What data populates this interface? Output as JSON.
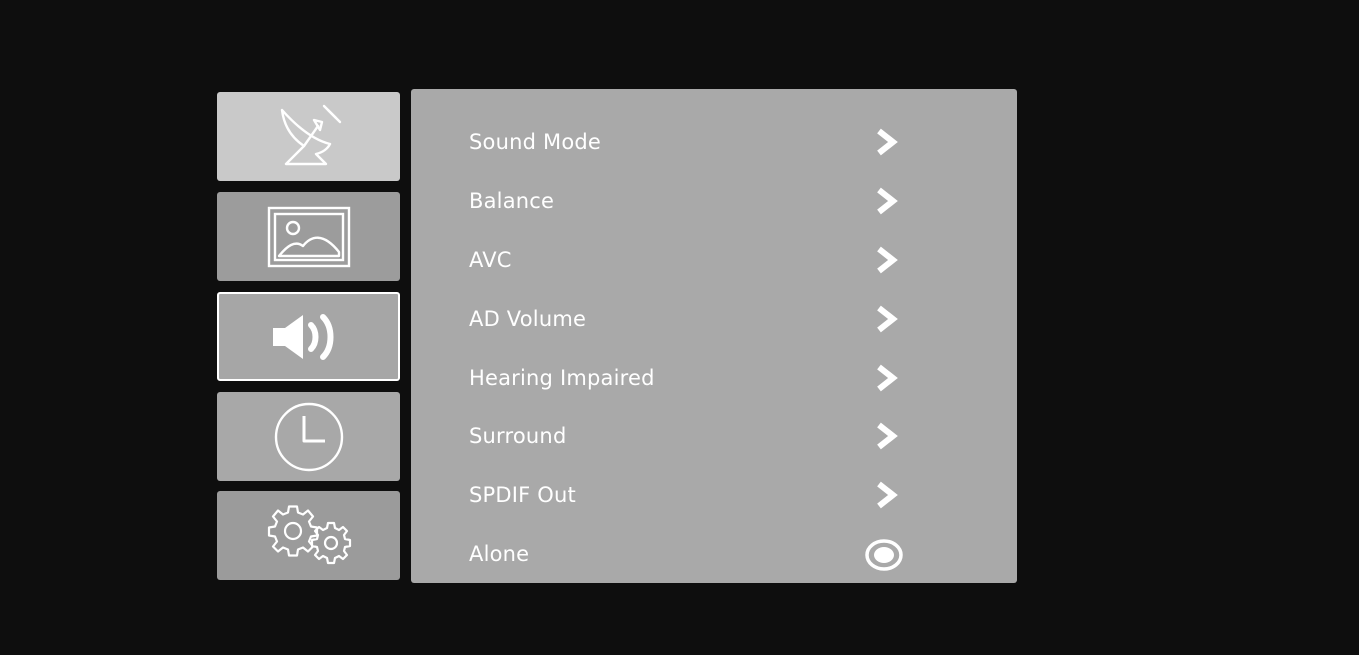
{
  "menu_items": [
    {
      "label": "Sound Mode",
      "control": "chevron-right-icon"
    },
    {
      "label": "Balance",
      "control": "chevron-right-icon"
    },
    {
      "label": "AVC",
      "control": "chevron-right-icon"
    },
    {
      "label": "AD Volume",
      "control": "chevron-right-icon"
    },
    {
      "label": "Hearing Impaired",
      "control": "chevron-right-icon"
    },
    {
      "label": "Surround",
      "control": "chevron-right-icon"
    },
    {
      "label": "SPDIF Out",
      "control": "chevron-right-icon"
    },
    {
      "label": "Alone",
      "control": "radio-selected-icon"
    }
  ],
  "sidebar": {
    "tabs": [
      {
        "icon": "satellite-dish-icon"
      },
      {
        "icon": "picture-icon"
      },
      {
        "icon": "speaker-volume-icon",
        "selected": true
      },
      {
        "icon": "clock-icon"
      },
      {
        "icon": "gears-icon"
      }
    ]
  },
  "colors": {
    "background": "#0e0e0e",
    "panel": "#a9a9a9",
    "text": "#ffffff",
    "selected_border": "#ffffff"
  }
}
